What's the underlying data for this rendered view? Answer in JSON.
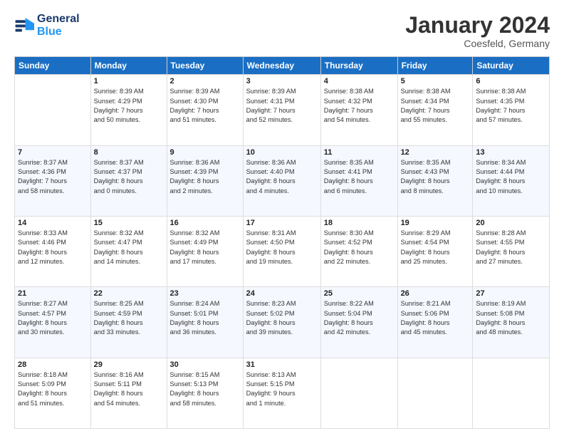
{
  "header": {
    "logo_line1": "General",
    "logo_line2": "Blue",
    "month": "January 2024",
    "location": "Coesfeld, Germany"
  },
  "days_of_week": [
    "Sunday",
    "Monday",
    "Tuesday",
    "Wednesday",
    "Thursday",
    "Friday",
    "Saturday"
  ],
  "weeks": [
    [
      {
        "num": "",
        "info": ""
      },
      {
        "num": "1",
        "info": "Sunrise: 8:39 AM\nSunset: 4:29 PM\nDaylight: 7 hours\nand 50 minutes."
      },
      {
        "num": "2",
        "info": "Sunrise: 8:39 AM\nSunset: 4:30 PM\nDaylight: 7 hours\nand 51 minutes."
      },
      {
        "num": "3",
        "info": "Sunrise: 8:39 AM\nSunset: 4:31 PM\nDaylight: 7 hours\nand 52 minutes."
      },
      {
        "num": "4",
        "info": "Sunrise: 8:38 AM\nSunset: 4:32 PM\nDaylight: 7 hours\nand 54 minutes."
      },
      {
        "num": "5",
        "info": "Sunrise: 8:38 AM\nSunset: 4:34 PM\nDaylight: 7 hours\nand 55 minutes."
      },
      {
        "num": "6",
        "info": "Sunrise: 8:38 AM\nSunset: 4:35 PM\nDaylight: 7 hours\nand 57 minutes."
      }
    ],
    [
      {
        "num": "7",
        "info": "Sunrise: 8:37 AM\nSunset: 4:36 PM\nDaylight: 7 hours\nand 58 minutes."
      },
      {
        "num": "8",
        "info": "Sunrise: 8:37 AM\nSunset: 4:37 PM\nDaylight: 8 hours\nand 0 minutes."
      },
      {
        "num": "9",
        "info": "Sunrise: 8:36 AM\nSunset: 4:39 PM\nDaylight: 8 hours\nand 2 minutes."
      },
      {
        "num": "10",
        "info": "Sunrise: 8:36 AM\nSunset: 4:40 PM\nDaylight: 8 hours\nand 4 minutes."
      },
      {
        "num": "11",
        "info": "Sunrise: 8:35 AM\nSunset: 4:41 PM\nDaylight: 8 hours\nand 6 minutes."
      },
      {
        "num": "12",
        "info": "Sunrise: 8:35 AM\nSunset: 4:43 PM\nDaylight: 8 hours\nand 8 minutes."
      },
      {
        "num": "13",
        "info": "Sunrise: 8:34 AM\nSunset: 4:44 PM\nDaylight: 8 hours\nand 10 minutes."
      }
    ],
    [
      {
        "num": "14",
        "info": "Sunrise: 8:33 AM\nSunset: 4:46 PM\nDaylight: 8 hours\nand 12 minutes."
      },
      {
        "num": "15",
        "info": "Sunrise: 8:32 AM\nSunset: 4:47 PM\nDaylight: 8 hours\nand 14 minutes."
      },
      {
        "num": "16",
        "info": "Sunrise: 8:32 AM\nSunset: 4:49 PM\nDaylight: 8 hours\nand 17 minutes."
      },
      {
        "num": "17",
        "info": "Sunrise: 8:31 AM\nSunset: 4:50 PM\nDaylight: 8 hours\nand 19 minutes."
      },
      {
        "num": "18",
        "info": "Sunrise: 8:30 AM\nSunset: 4:52 PM\nDaylight: 8 hours\nand 22 minutes."
      },
      {
        "num": "19",
        "info": "Sunrise: 8:29 AM\nSunset: 4:54 PM\nDaylight: 8 hours\nand 25 minutes."
      },
      {
        "num": "20",
        "info": "Sunrise: 8:28 AM\nSunset: 4:55 PM\nDaylight: 8 hours\nand 27 minutes."
      }
    ],
    [
      {
        "num": "21",
        "info": "Sunrise: 8:27 AM\nSunset: 4:57 PM\nDaylight: 8 hours\nand 30 minutes."
      },
      {
        "num": "22",
        "info": "Sunrise: 8:25 AM\nSunset: 4:59 PM\nDaylight: 8 hours\nand 33 minutes."
      },
      {
        "num": "23",
        "info": "Sunrise: 8:24 AM\nSunset: 5:01 PM\nDaylight: 8 hours\nand 36 minutes."
      },
      {
        "num": "24",
        "info": "Sunrise: 8:23 AM\nSunset: 5:02 PM\nDaylight: 8 hours\nand 39 minutes."
      },
      {
        "num": "25",
        "info": "Sunrise: 8:22 AM\nSunset: 5:04 PM\nDaylight: 8 hours\nand 42 minutes."
      },
      {
        "num": "26",
        "info": "Sunrise: 8:21 AM\nSunset: 5:06 PM\nDaylight: 8 hours\nand 45 minutes."
      },
      {
        "num": "27",
        "info": "Sunrise: 8:19 AM\nSunset: 5:08 PM\nDaylight: 8 hours\nand 48 minutes."
      }
    ],
    [
      {
        "num": "28",
        "info": "Sunrise: 8:18 AM\nSunset: 5:09 PM\nDaylight: 8 hours\nand 51 minutes."
      },
      {
        "num": "29",
        "info": "Sunrise: 8:16 AM\nSunset: 5:11 PM\nDaylight: 8 hours\nand 54 minutes."
      },
      {
        "num": "30",
        "info": "Sunrise: 8:15 AM\nSunset: 5:13 PM\nDaylight: 8 hours\nand 58 minutes."
      },
      {
        "num": "31",
        "info": "Sunrise: 8:13 AM\nSunset: 5:15 PM\nDaylight: 9 hours\nand 1 minute."
      },
      {
        "num": "",
        "info": ""
      },
      {
        "num": "",
        "info": ""
      },
      {
        "num": "",
        "info": ""
      }
    ]
  ]
}
